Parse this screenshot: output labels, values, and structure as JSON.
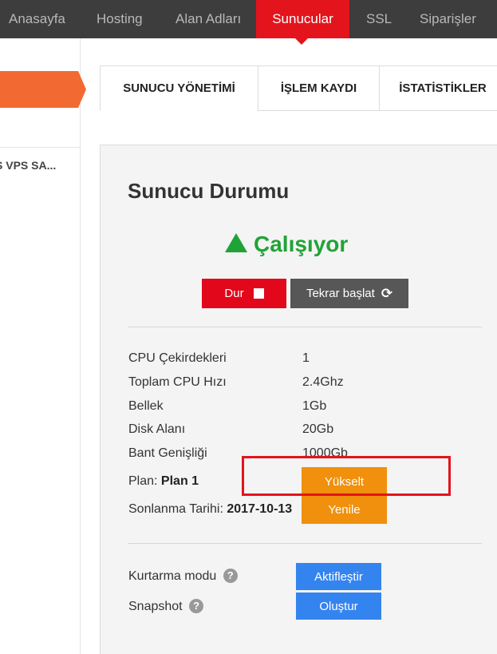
{
  "nav": {
    "items": [
      "Anasayfa",
      "Hosting",
      "Alan Adları",
      "Sunucular",
      "SSL",
      "Siparişler"
    ],
    "active": "Sunucular"
  },
  "sidebar": {
    "item_label": "S VPS SA..."
  },
  "tabs": [
    "SUNUCU YÖNETİMİ",
    "İŞLEM KAYDI",
    "İSTATİSTİKLER"
  ],
  "panel": {
    "title": "Sunucu Durumu",
    "status": "Çalışıyor",
    "stop_label": "Dur",
    "restart_label": "Tekrar başlat",
    "specs": [
      {
        "label": "CPU Çekirdekleri",
        "value": "1"
      },
      {
        "label": "Toplam CPU Hızı",
        "value": "2.4Ghz"
      },
      {
        "label": "Bellek",
        "value": "1Gb"
      },
      {
        "label": "Disk Alanı",
        "value": "20Gb"
      },
      {
        "label": "Bant Genişliği",
        "value": "1000Gb"
      }
    ],
    "plan_label": "Plan:",
    "plan_value": "Plan 1",
    "upgrade_label": "Yükselt",
    "expiry_label": "Sonlanma Tarihi:",
    "expiry_value": "2017-10-13",
    "renew_label": "Yenile",
    "rescue_label": "Kurtarma modu",
    "activate_label": "Aktifleştir",
    "snapshot_label": "Snapshot",
    "create_label": "Oluştur"
  },
  "colors": {
    "nav_active": "#e3141c",
    "status_green": "#20a336",
    "orange": "#f0900c",
    "blue": "#3484f0",
    "highlight": "#e3141c"
  }
}
